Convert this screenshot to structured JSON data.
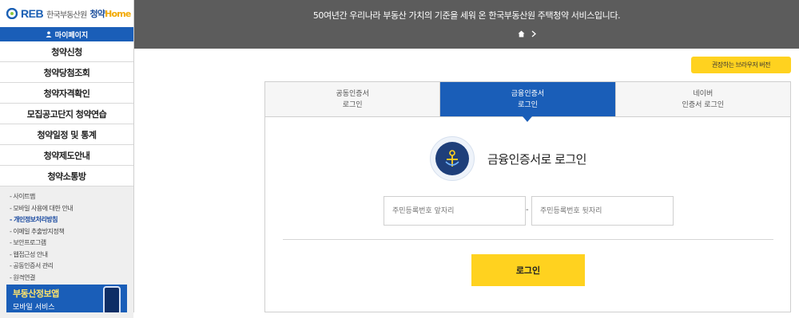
{
  "logo": {
    "reb": "REB",
    "org": "한국부동산원",
    "brand_a": "청약",
    "brand_b": "Home"
  },
  "sidebar": {
    "mypage": "마이페이지",
    "items": [
      "청약신청",
      "청약당첨조회",
      "청약자격확인",
      "모집공고단지 청약연습",
      "청약일정 및 통계",
      "청약제도안내",
      "청약소통방"
    ],
    "sublinks": [
      "- 사이트맵",
      "- 모바일 사용에 대한 안내",
      "- 개인정보처리방침",
      "- 이메일 추출방지정책",
      "- 보안프로그램",
      "- 웹접근성 안내",
      "- 공동인증서 관리",
      "- 원격연결"
    ],
    "active_sublink": 2,
    "banner": {
      "title": "부동산정보앱",
      "subtitle": "모바일 서비스"
    }
  },
  "header": {
    "message": "50여년간 우리나라 부동산 가치의 기준을 세워 온 한국부동산원 주택청약 서비스입니다."
  },
  "browser_button": "권장하는 브라우저 버전",
  "tabs": [
    {
      "line1": "공동인증서",
      "line2": "로그인"
    },
    {
      "line1": "금융인증서",
      "line2": "로그인"
    },
    {
      "line1": "네이버",
      "line2": "인증서 로그인"
    }
  ],
  "active_tab": 1,
  "login": {
    "title": "금융인증서로 로그인",
    "front_placeholder": "주민등록번호 앞자리",
    "back_placeholder": "주민등록번호 뒷자리",
    "separator": "-",
    "button": "로그인"
  },
  "colors": {
    "primary": "#1a5eb8",
    "accent": "#ffd21f",
    "header_bg": "#5c5c5c"
  },
  "icons": [
    "home-icon",
    "chevron-right-icon",
    "user-icon",
    "certificate-icon"
  ]
}
